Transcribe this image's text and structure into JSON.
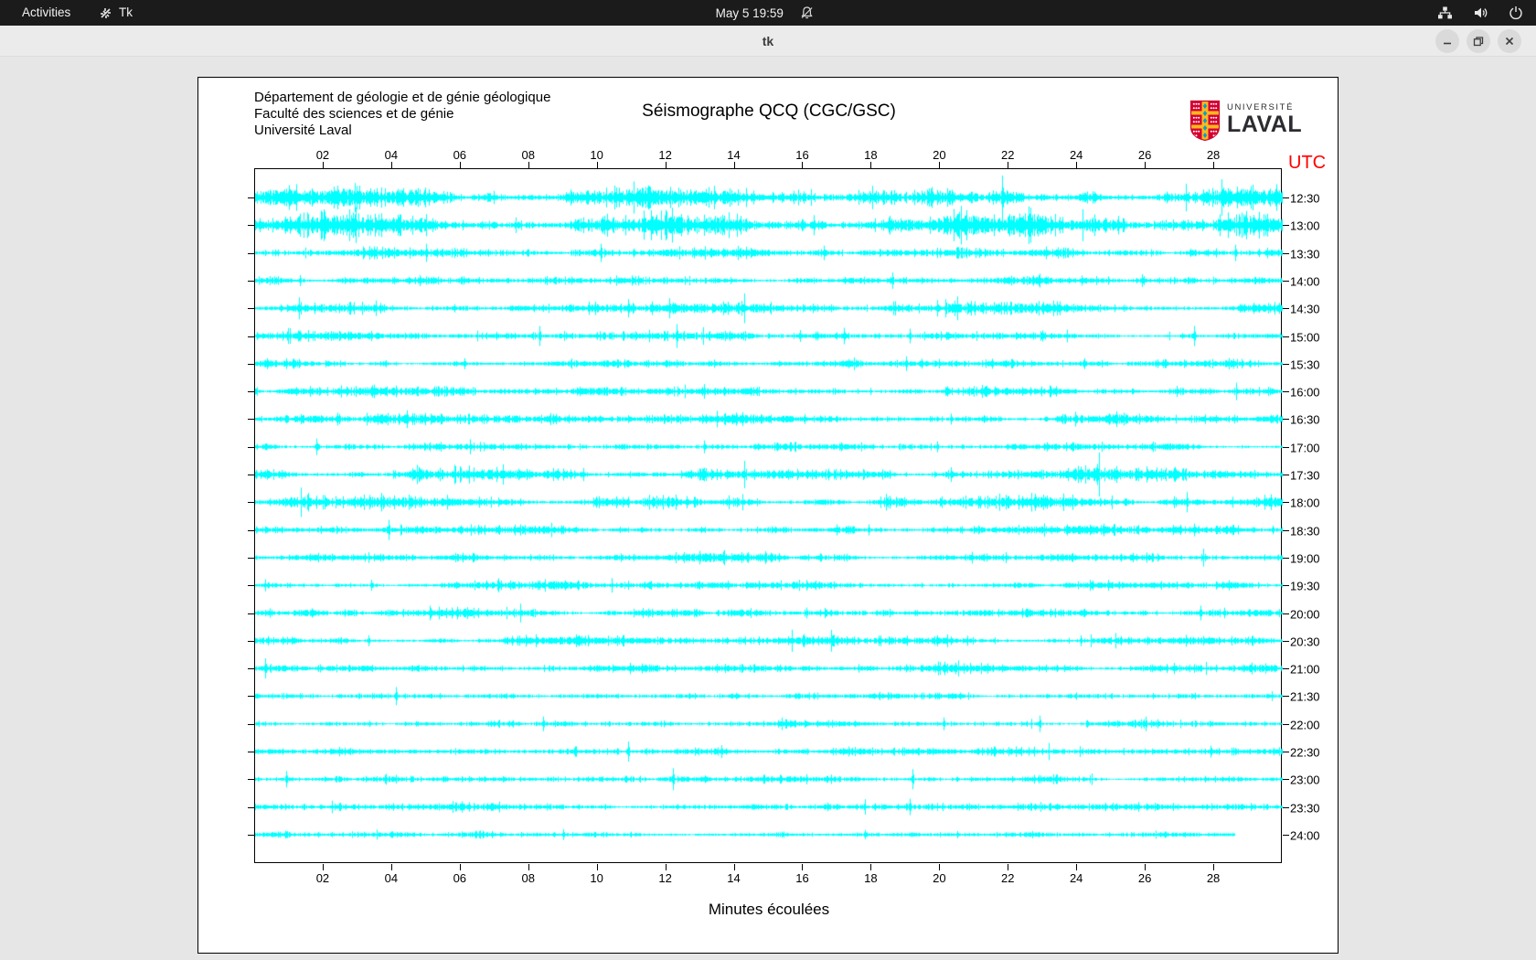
{
  "topbar": {
    "activities": "Activities",
    "app_label": "Tk",
    "clock": "May 5 19:59"
  },
  "titlebar": {
    "title": "tk"
  },
  "header": {
    "line1": "Département de géologie et de génie géologique",
    "line2": "Faculté des sciences et de génie",
    "line3": "Université Laval",
    "title": "Séismographe QCQ (CGC/GSC)"
  },
  "logo": {
    "line1": "UNIVERSITÉ",
    "line2": "LAVAL"
  },
  "chart_data": {
    "type": "line",
    "subtype": "seismogram-helicorder",
    "title": "Séismographe QCQ (CGC/GSC)",
    "xlabel": "Minutes écoulées",
    "x_range": [
      0,
      30
    ],
    "x_ticks": [
      "02",
      "04",
      "06",
      "08",
      "10",
      "12",
      "14",
      "16",
      "18",
      "20",
      "22",
      "24",
      "26",
      "28"
    ],
    "x_ticks_shown_top_and_bottom": true,
    "right_axis_label": "UTC",
    "right_axis_color": "#ff0000",
    "trace_color": "#00ffff",
    "background": "#ffffff",
    "rows": [
      {
        "time": "12:30",
        "amp": 5.2,
        "burst": 0.9,
        "spikes": [
          [
            10.5,
            13
          ],
          [
            21.8,
            24
          ],
          [
            28.2,
            20
          ]
        ]
      },
      {
        "time": "13:00",
        "amp": 5.6,
        "burst": 0.9,
        "spikes": [
          [
            16.3,
            11
          ],
          [
            23.5,
            9
          ]
        ]
      },
      {
        "time": "13:30",
        "amp": 2.4,
        "burst": 0.5,
        "spikes": [
          [
            5.0,
            10
          ],
          [
            10.1,
            10
          ],
          [
            16.6,
            8
          ],
          [
            28.6,
            9
          ]
        ]
      },
      {
        "time": "14:00",
        "amp": 2.2,
        "burst": 0.4,
        "spikes": [
          [
            1.3,
            6
          ],
          [
            18.6,
            9
          ],
          [
            25.9,
            7
          ]
        ]
      },
      {
        "time": "14:30",
        "amp": 2.6,
        "burst": 0.6,
        "spikes": [
          [
            10.9,
            10
          ],
          [
            12.1,
            11
          ],
          [
            14.2,
            8
          ],
          [
            19.9,
            9
          ],
          [
            23.0,
            7
          ]
        ]
      },
      {
        "time": "15:00",
        "amp": 2.2,
        "burst": 0.4,
        "spikes": [
          [
            8.3,
            11
          ],
          [
            12.3,
            13
          ],
          [
            17.2,
            9
          ],
          [
            19.1,
            8
          ],
          [
            27.4,
            11
          ]
        ]
      },
      {
        "time": "15:30",
        "amp": 2.1,
        "burst": 0.4,
        "spikes": [
          [
            6.1,
            6
          ],
          [
            19.0,
            8
          ],
          [
            24.2,
            6
          ]
        ]
      },
      {
        "time": "16:00",
        "amp": 2.4,
        "burst": 0.5,
        "spikes": [
          [
            13.1,
            8
          ],
          [
            26.9,
            6
          ]
        ]
      },
      {
        "time": "16:30",
        "amp": 2.4,
        "burst": 0.5,
        "spikes": [
          [
            2.4,
            7
          ],
          [
            20.3,
            6
          ]
        ]
      },
      {
        "time": "17:00",
        "amp": 2.2,
        "burst": 0.4,
        "spikes": [
          [
            1.8,
            9
          ],
          [
            13.1,
            7
          ],
          [
            19.9,
            6
          ]
        ]
      },
      {
        "time": "17:30",
        "amp": 2.9,
        "burst": 0.7,
        "spikes": [
          [
            20.3,
            8
          ],
          [
            25.1,
            7
          ],
          [
            25.7,
            7
          ]
        ]
      },
      {
        "time": "18:00",
        "amp": 3.1,
        "burst": 0.7,
        "spikes": [
          [
            5.6,
            8
          ],
          [
            10.9,
            6
          ],
          [
            21.9,
            8
          ]
        ]
      },
      {
        "time": "18:30",
        "amp": 2.4,
        "burst": 0.5,
        "spikes": [
          [
            3.9,
            11
          ],
          [
            17.9,
            6
          ],
          [
            27.4,
            7
          ]
        ]
      },
      {
        "time": "19:00",
        "amp": 2.2,
        "burst": 0.4,
        "spikes": [
          [
            14.9,
            7
          ],
          [
            21.9,
            6
          ]
        ]
      },
      {
        "time": "19:30",
        "amp": 2.1,
        "burst": 0.4,
        "spikes": [
          [
            3.4,
            6
          ],
          [
            24.9,
            6
          ]
        ]
      },
      {
        "time": "20:00",
        "amp": 2.1,
        "burst": 0.4,
        "spikes": [
          [
            5.1,
            8
          ],
          [
            16.1,
            6
          ],
          [
            27.6,
            8
          ]
        ]
      },
      {
        "time": "20:30",
        "amp": 2.4,
        "burst": 0.5,
        "spikes": [
          [
            3.3,
            6
          ],
          [
            19.9,
            6
          ],
          [
            24.1,
            6
          ]
        ]
      },
      {
        "time": "21:00",
        "amp": 2.1,
        "burst": 0.4,
        "spikes": [
          [
            0.3,
            11
          ],
          [
            26.6,
            5
          ]
        ]
      },
      {
        "time": "21:30",
        "amp": 1.7,
        "burst": 0.3,
        "spikes": [
          [
            4.1,
            10
          ]
        ]
      },
      {
        "time": "22:00",
        "amp": 1.7,
        "burst": 0.3,
        "spikes": [
          [
            8.4,
            8
          ],
          [
            20.1,
            7
          ],
          [
            22.9,
            9
          ],
          [
            26.0,
            8
          ]
        ]
      },
      {
        "time": "22:30",
        "amp": 1.7,
        "burst": 0.3,
        "spikes": [
          [
            10.9,
            11
          ],
          [
            13.6,
            7
          ]
        ]
      },
      {
        "time": "23:00",
        "amp": 1.7,
        "burst": 0.3,
        "spikes": [
          [
            0.9,
            9
          ],
          [
            12.2,
            12
          ],
          [
            19.2,
            11
          ]
        ]
      },
      {
        "time": "23:30",
        "amp": 1.7,
        "burst": 0.3,
        "spikes": [
          [
            19.1,
            9
          ]
        ]
      },
      {
        "time": "24:00",
        "amp": 1.4,
        "burst": 0.25,
        "end_minute": 28.6,
        "spikes": [
          [
            9.0,
            6
          ],
          [
            17.8,
            5
          ],
          [
            20.5,
            4
          ]
        ]
      }
    ]
  }
}
